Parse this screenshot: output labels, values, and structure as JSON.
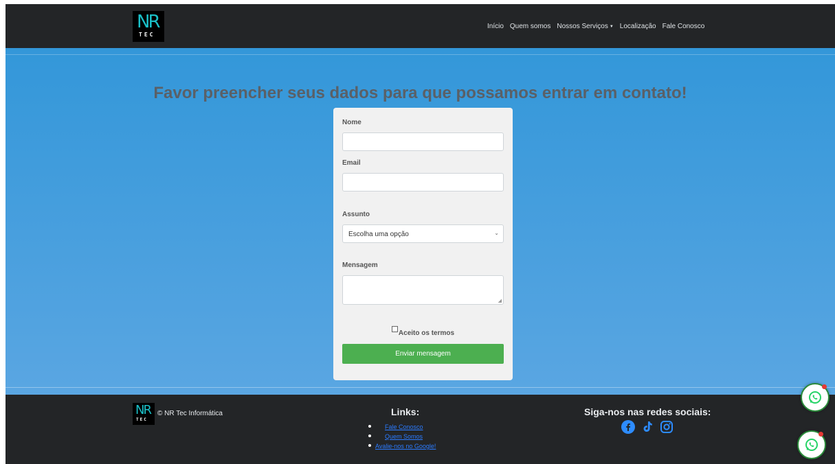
{
  "navbar": {
    "logo_text_top": "NR",
    "logo_text_bottom": "TEC",
    "items": [
      {
        "label": "Início"
      },
      {
        "label": "Quem somos"
      },
      {
        "label": "Nossos Serviços",
        "dropdown": true
      },
      {
        "label": "Localização"
      },
      {
        "label": "Fale Conosco"
      }
    ]
  },
  "main": {
    "heading": "Favor preencher seus dados para que possamos entrar em contato!",
    "form": {
      "name_label": "Nome",
      "name_value": "",
      "email_label": "Email",
      "email_value": "",
      "subject_label": "Assunto",
      "subject_selected": "Escolha uma opção",
      "message_label": "Mensagem",
      "message_value": "",
      "terms_label": "Aceito os termos",
      "terms_checked": false,
      "submit_label": "Enviar mensagem"
    }
  },
  "footer": {
    "logo_text_top": "NR",
    "logo_text_bottom": "TEC",
    "copyright": "© NR Tec Informática",
    "links_title": "Links:",
    "links": [
      {
        "label": "Fale Conosco"
      },
      {
        "label": "Quem Somos"
      },
      {
        "label": "Avalie-nos no Google!"
      }
    ],
    "social_title": "Siga-nos nas redes sociais:",
    "social_icons": [
      "facebook-icon",
      "tiktok-icon",
      "instagram-icon"
    ]
  },
  "colors": {
    "navbar_bg": "#232527",
    "gradient_top": "#3397d9",
    "gradient_bottom": "#5aa6e2",
    "submit_bg": "#4caf50",
    "link_color": "#2b7bff",
    "social_icon_color": "#2d8cff",
    "whatsapp_green": "#25d366"
  }
}
